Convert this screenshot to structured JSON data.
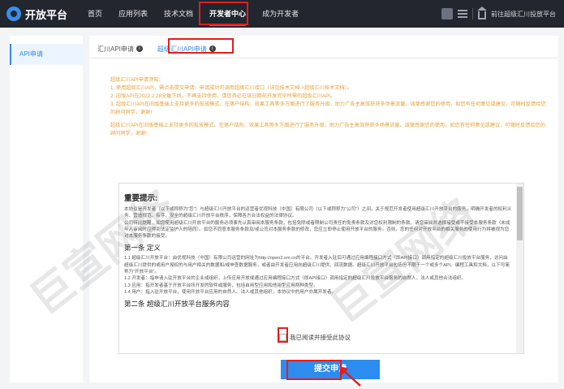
{
  "header": {
    "logo_text": "开放平台",
    "nav": [
      "首页",
      "应用列表",
      "技术文档",
      "开发者中心",
      "成为开发者"
    ],
    "active_index": 3,
    "back_link": "前往超级汇川投放平台"
  },
  "sidebar": {
    "items": [
      {
        "label": "API申请"
      }
    ]
  },
  "tabs": [
    {
      "label": "汇川API申请",
      "active": false
    },
    {
      "label": "超级汇川API申请",
      "active": true
    }
  ],
  "notice": {
    "heading": "超级汇川API申请须知：",
    "items": [
      "1. 使用超级汇川API，需点击提交申请；申请成功可调用超级汇川接口（详见技术文档->超级汇川技术文档）。",
      "2. 旧版API在2022.2.28全量下线，不再支持使用，请您务必在该日期前开发完毕所需的超级汇川API。",
      "3. 超级汇川API在旧版基础上支持更多的投放模式、在落户结构、效果工具等多方面进行了服务升级，助力广告主高效获获多场景流量、诚挚感谢您的使用，如您有任何意见或建议，可随时反馈给您的顾问同学，谢谢!"
    ],
    "extra": "超级汇川API在旧版基础上支持更多的投放模式、在落户结构、效果工具等多方面进行了服务升级，助力广告主高效获获多场景流量、诚挚感谢您的使用，如您有任何意见或建议，可随时反馈给您的顾问同学，谢谢!"
  },
  "agreement": {
    "title": "重要提示:",
    "intro": "本协议是开发者（以下或称称为“您”）与超级汇川开放平台的运营者优视科技（中国）有限公司（以下或称称为“公司”）之间，关于规范开发者使用超级汇川开放平台的服务，明确开发者的权利义务、营造规范、有序、安全的超级汇川开放平台秩序，保障各方合法权益的法律协议。",
    "intro2": "公司特此提醒，如您使用超级汇川开放平台的服务必须事先认真审阅本服务条款，包括免除或者限制公司责任的免责条款及对您权利限制的条款。请您审阅并选择接受或不接受本服务条款（未成年人审阅时应得到法定监护人的陪同）。如您不同意本服务条款及/或公司对本服务条款的修改，您应立即停止使用开放平台的服务。否则，您的任何对开放平台的相关服务的使用行为将被视为您对本服务条款的接受。",
    "section1": "第一条 定义",
    "def1": "1.1 超级汇川开放平台：由优视科技（中国）有限公司运营的网址为http://open2.sm.cn的平台。开发者入驻后可通过应用编程接口方式（即API接口）调用指定的超级汇川投放平台服务，访问由超级汇川提供的或用户授权的与用户相关的数据和/或申查数据服务，或者由开发者应用向超级汇川提供、回流数据。超级汇川开放平台包括但不限于一个或多个API、编程工具和文档，以下可简称为“开放平台”。",
    "def2": "1.2 开发者：指申请入驻开放平台的企业或组织，上传应用开放或通过应用编程接口方式（即API接口）调用指定的超级汇川投放平台服务的自然人、法人或其他合法组织。",
    "def3": "1.3 应用：指开发者基于开放平台所开发的软件或服务，包括自用型应用和他用型应用两种类型。",
    "def4": "1.4 用户：指入驻开放平台，使用开放平台应用的自然人、法人或其他组织，本协议中的用户亦属开发者。",
    "section2": "第二条 超级汇川开放平台服务内容"
  },
  "checkbox": {
    "label": "我已阅读并接受此协议",
    "checked": false
  },
  "submit": {
    "label": "提交申请"
  },
  "watermark": [
    "巨宣网络",
    "巨宣网络"
  ],
  "colors": {
    "accent": "#2d8cf0",
    "highlight": "#e41d1d",
    "notice": "#e6a23c",
    "topbar": "#22262e"
  }
}
